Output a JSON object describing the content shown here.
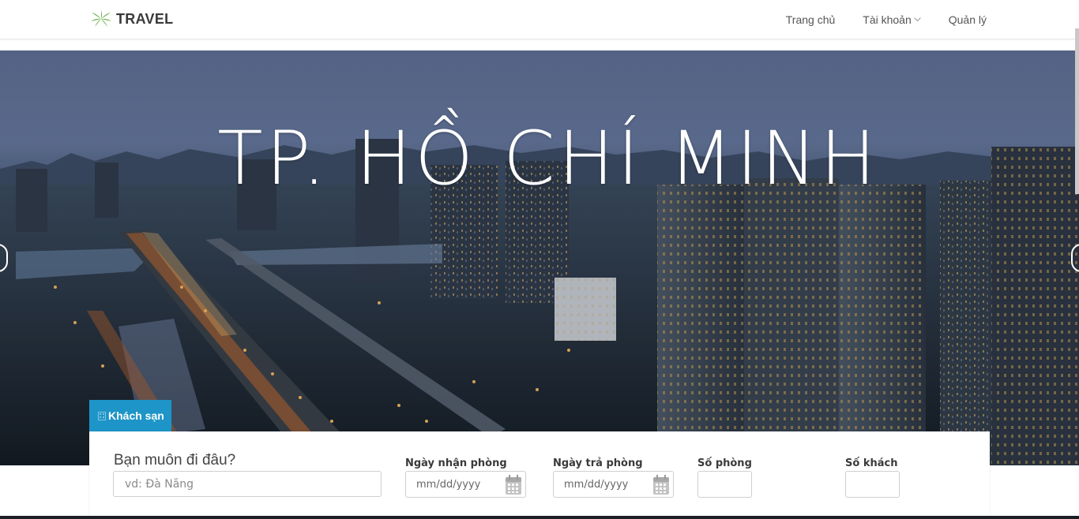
{
  "navbar": {
    "brand": "TRAVEL",
    "links": {
      "home": "Trang chủ",
      "account": "Tài khoản",
      "manage": "Quản lý"
    }
  },
  "hero": {
    "title": "TP. HỒ CHÍ MINH"
  },
  "search": {
    "tab_label": "Khách sạn",
    "where_label": "Bạn muôn đi đâu?",
    "where_placeholder": "vd: Đà Nẵng",
    "checkin_label": "Ngày nhận phòng",
    "checkin_value": "mm/dd/yyyy",
    "checkout_label": "Ngày trả phòng",
    "checkout_value": "mm/dd/yyyy",
    "rooms_label": "Số phòng",
    "guests_label": "Số khách"
  },
  "colors": {
    "accent": "#1e95c8",
    "brand_leaf": "#6ab04c"
  }
}
